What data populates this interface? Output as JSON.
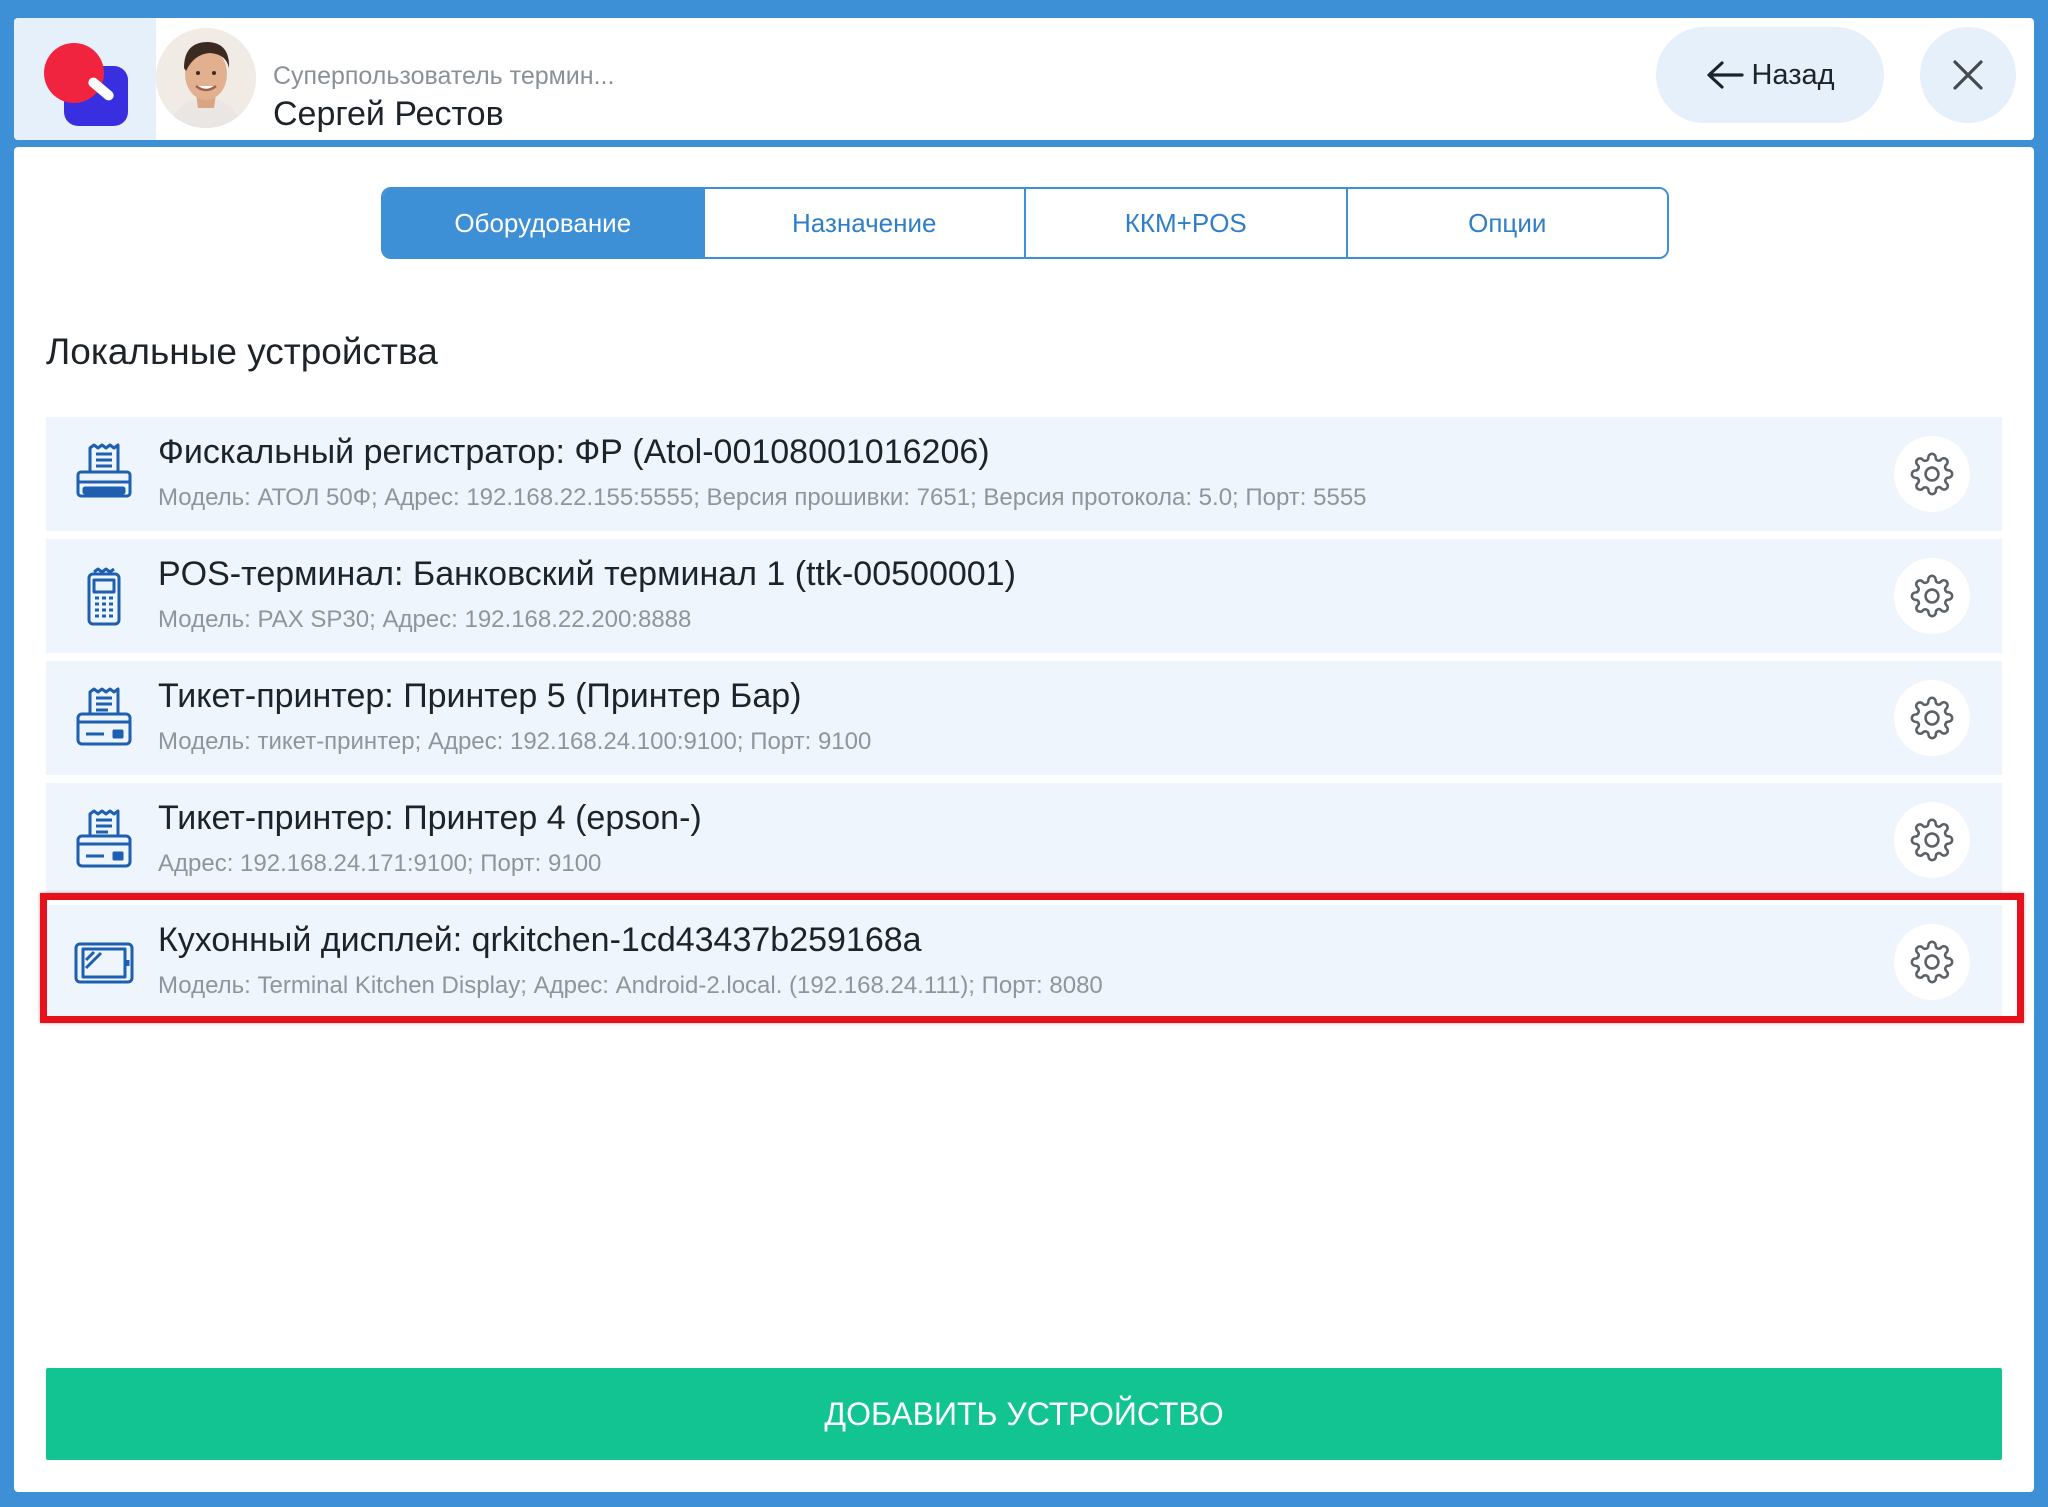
{
  "header": {
    "user_role": "Суперпользователь термин...",
    "user_name": "Сергей Рестов",
    "back_label": "Назад"
  },
  "tabs": [
    {
      "label": "Оборудование",
      "active": true
    },
    {
      "label": "Назначение",
      "active": false
    },
    {
      "label": "ККМ+POS",
      "active": false
    },
    {
      "label": "Опции",
      "active": false
    }
  ],
  "section_title": "Локальные устройства",
  "devices": [
    {
      "title": "Фискальный регистратор: ФР (Atol-00108001016206)",
      "details": "Модель: АТОЛ 50Ф; Адрес: 192.168.22.155:5555; Версия прошивки: 7651; Версия протокола: 5.0; Порт: 5555",
      "icon": "fiscal-printer-icon"
    },
    {
      "title": "POS-терминал: Банковский терминал 1 (ttk-00500001)",
      "details": "Модель: PAX SP30; Адрес: 192.168.22.200:8888",
      "icon": "pos-terminal-icon"
    },
    {
      "title": "Тикет-принтер: Принтер 5 (Принтер Бар)",
      "details": "Модель: тикет-принтер; Адрес: 192.168.24.100:9100; Порт: 9100",
      "icon": "ticket-printer-icon"
    },
    {
      "title": "Тикет-принтер: Принтер 4 (epson-)",
      "details": "Адрес: 192.168.24.171:9100; Порт: 9100",
      "icon": "ticket-printer-icon"
    },
    {
      "title": "Кухонный дисплей: qrkitchen-1cd43437b259168a",
      "details": "Модель: Terminal Kitchen Display; Адрес: Android-2.local. (192.168.24.111); Порт: 8080",
      "icon": "kitchen-display-icon",
      "highlighted": true
    }
  ],
  "add_button_label": "ДОБАВИТЬ УСТРОЙСТВО",
  "colors": {
    "frame": "#3d8fd6",
    "accent_blue": "#3d8fd6",
    "row_bg": "#eef5fc",
    "add_button": "#12c492",
    "highlight": "#e8101a"
  }
}
